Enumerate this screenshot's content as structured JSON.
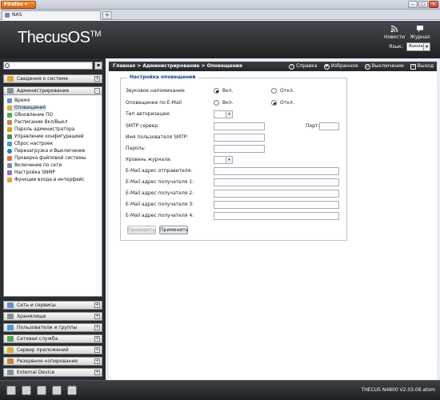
{
  "browser": {
    "app_button": "Firefox",
    "tab_title": "NAS",
    "new_tab": "+"
  },
  "header": {
    "logo": "ThecusOS",
    "logo_tm": "TM",
    "news_label": "Новости",
    "journal_label": "Журнал",
    "lang_label": "Язык:",
    "lang_value": "Russia"
  },
  "sidebar": {
    "search_placeholder": "",
    "groups": [
      "Сведения о системе",
      "Администрирование",
      "Сеть и сервисы",
      "Хранилище",
      "Пользователи и группы",
      "Сетевая служба",
      "Сервер приложений",
      "Резервное копирование",
      "External Device"
    ],
    "admin_items": [
      "Время",
      "Оповещения",
      "Обновление ПО",
      "Расписание Вкл/Выкл",
      "Пароль администратора",
      "Управление конфигурацией",
      "Сброс настроек",
      "Перезагрузка и Выключение",
      "Проверка файловой системы",
      "Включение по сети",
      "Настройка SNMP",
      "Функции входа в интерфейс"
    ]
  },
  "navbar": {
    "breadcrumb": "Главная > Администрирование > Оповещения",
    "help": "Справка",
    "favorites": "Избранное",
    "shutdown": "Выключение",
    "logout": "Выход"
  },
  "form": {
    "legend": "Настройка оповещений",
    "beep_label": "Звуковое напоминание",
    "email_label": "Оповещение по E-Mail",
    "on": "Вкл.",
    "off": "Откл.",
    "auth_label": "Тип авторизации:",
    "smtp_label": "SMTP сервер:",
    "port_label": "Порт:",
    "user_label": "Имя пользователя SMTP:",
    "password_label": "Пароль:",
    "level_label": "Уровень журнала:",
    "sender_label": "E-Mail адрес отправителя:",
    "recipient1_label": "E-Mail адрес получателя 1:",
    "recipient2_label": "E-Mail адрес получателя 2:",
    "recipient3_label": "E-Mail адрес получателя 3:",
    "recipient4_label": "E-Mail адрес получателя 4:",
    "test_button": "Проверить",
    "apply_button": "Применить",
    "beep_selected": "on",
    "email_selected": "off"
  },
  "taskbar": {
    "status": "THECUS N4800  V2.03.06.atom"
  }
}
